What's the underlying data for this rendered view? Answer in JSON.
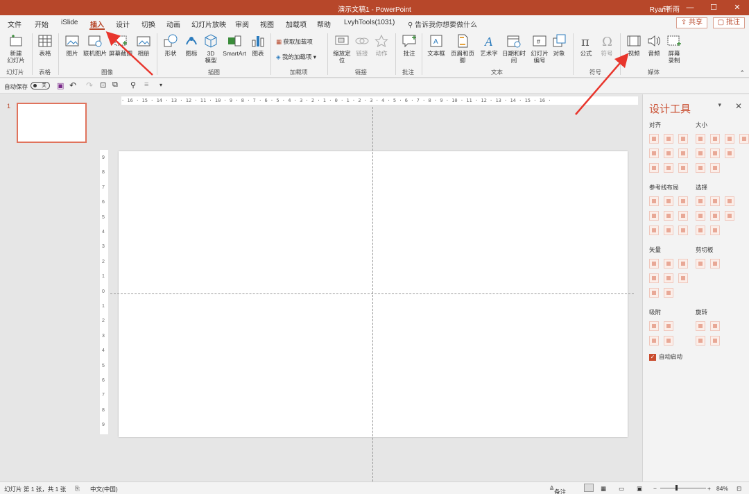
{
  "titlebar": {
    "doc_title": "演示文稿1  -  PowerPoint",
    "user": "Ryan祈雨",
    "buttons": [
      "▭",
      "—",
      "☐",
      "✕"
    ]
  },
  "menu": {
    "tabs": [
      "文件",
      "开始",
      "iSlide",
      "插入",
      "设计",
      "切换",
      "动画",
      "幻灯片放映",
      "审阅",
      "视图",
      "加载项",
      "帮助",
      "LvyhTools(1031)"
    ],
    "active_tab": "插入",
    "tell_me": "告诉我你想要做什么",
    "share": "共享",
    "comment": "批注"
  },
  "ribbon": {
    "slides": {
      "new_slide": "新建\n幻灯片",
      "group": "幻灯片"
    },
    "tables": {
      "table": "表格",
      "group": "表格"
    },
    "images": {
      "picture": "图片",
      "online_picture": "联机图片",
      "screenshot": "屏幕截图",
      "album": "相册",
      "group": "图像"
    },
    "illustrations": {
      "shapes": "形状",
      "icons": "图标",
      "model3d": "3D\n模型",
      "smartart": "SmartArt",
      "chart": "图表",
      "group": "插图"
    },
    "addins": {
      "get": "获取加载项",
      "my": "我的加载项",
      "group": "加载项"
    },
    "links": {
      "zoom": "缩放定\n位",
      "link": "链接",
      "action": "动作",
      "group": "链接"
    },
    "comments": {
      "comment": "批注",
      "group": "批注"
    },
    "text": {
      "textbox": "文本框",
      "header_footer": "页眉和页脚",
      "wordart": "艺术字",
      "datetime": "日期和时间",
      "slide_number": "幻灯片\n编号",
      "object": "对象",
      "group": "文本"
    },
    "symbols": {
      "equation": "公式",
      "symbol": "符号",
      "group": "符号"
    },
    "media": {
      "video": "视频",
      "audio": "音频",
      "screen_record": "屏幕\n录制",
      "group": "媒体"
    }
  },
  "qat": {
    "autosave_label": "自动保存",
    "toggle_state": "关"
  },
  "thumbnails": [
    {
      "number": "1"
    }
  ],
  "ruler": {
    "h_labels": "· 16 · 15 · 14 · 13 · 12 · 11 · 10 · 9 · 8 · 7 · 6 · 5 · 4 · 3 · 2 · 1 · 0 · 1 · 2 · 3 · 4 · 5 · 6 · 7 · 8 · 9 · 10 · 11 · 12 · 13 · 14 · 15 · 16 ·",
    "v_labels": [
      "9",
      "8",
      "7",
      "6",
      "5",
      "4",
      "3",
      "2",
      "1",
      "0",
      "1",
      "2",
      "3",
      "4",
      "5",
      "6",
      "7",
      "8",
      "9"
    ]
  },
  "design_tools": {
    "title": "设计工具",
    "sections": {
      "align": "对齐",
      "size": "大小",
      "guide_layout": "参考线布局",
      "select": "选择",
      "vector": "矢量",
      "clipboard": "剪切板",
      "snap": "吸附",
      "rotate": "旋转"
    },
    "autostart": "自动启动"
  },
  "statusbar": {
    "slide_info": "幻灯片 第 1 张，共 1 张",
    "language": "中文(中国)",
    "notes": "备注",
    "zoom": "84%"
  },
  "colors": {
    "accent": "#b7472a",
    "annotation": "#e8352c"
  }
}
